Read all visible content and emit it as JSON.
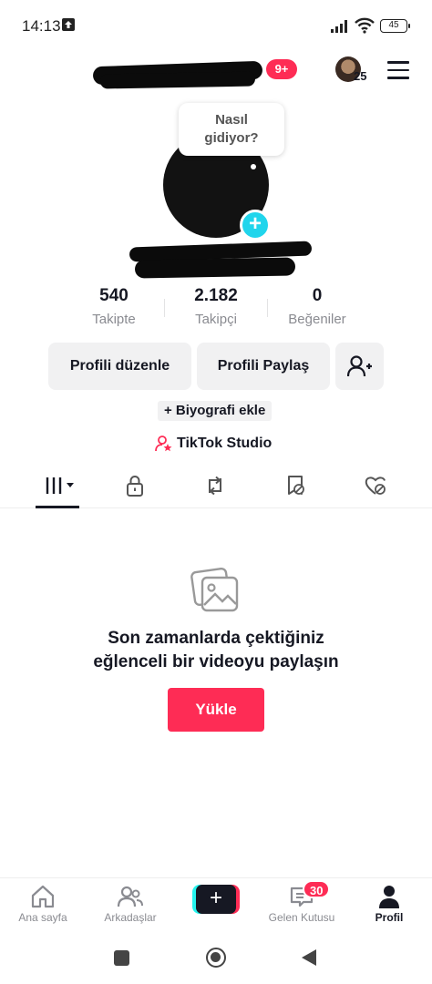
{
  "status_bar": {
    "time": "14:13",
    "battery": "45"
  },
  "header": {
    "notification_badge": "9+",
    "avatar_count": "25"
  },
  "profile": {
    "bubble_line1": "Nasıl",
    "bubble_line2": "gidiyor?",
    "stats": [
      {
        "value": "540",
        "label": "Takipte"
      },
      {
        "value": "2.182",
        "label": "Takipçi"
      },
      {
        "value": "0",
        "label": "Beğeniler"
      }
    ],
    "edit_button": "Profili düzenle",
    "share_button": "Profili Paylaş",
    "bio_add": "+ Biyografi ekle",
    "studio_label": "TikTok Studio"
  },
  "empty_state": {
    "title_line1": "Son zamanlarda çektiğiniz",
    "title_line2": "eğlenceli bir videoyu paylaşın",
    "upload_button": "Yükle"
  },
  "bottom_nav": {
    "home": "Ana sayfa",
    "friends": "Arkadaşlar",
    "create": "+",
    "inbox": "Gelen Kutusu",
    "inbox_badge": "30",
    "profile": "Profil"
  },
  "colors": {
    "accent": "#fe2c55",
    "cyan": "#20d5ec",
    "text": "#161823",
    "muted": "#8a8b91"
  }
}
